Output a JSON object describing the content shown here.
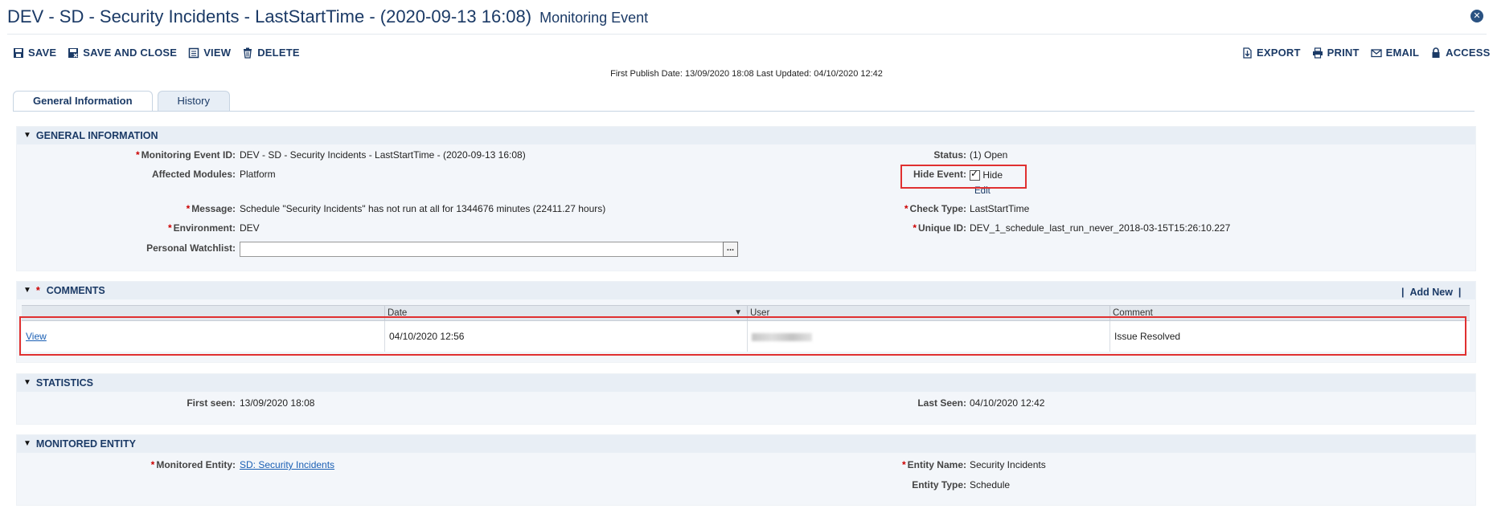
{
  "header": {
    "title": "DEV - SD - Security Incidents - LastStartTime - (2020-09-13 16:08)",
    "subtitle": "Monitoring Event",
    "close_icon": "close-icon"
  },
  "toolbar": {
    "left": [
      {
        "label": "SAVE",
        "icon": "save-icon"
      },
      {
        "label": "SAVE AND CLOSE",
        "icon": "save-close-icon"
      },
      {
        "label": "VIEW",
        "icon": "view-icon"
      },
      {
        "label": "DELETE",
        "icon": "trash-icon"
      }
    ],
    "right": [
      {
        "label": "EXPORT",
        "icon": "export-icon"
      },
      {
        "label": "PRINT",
        "icon": "printer-icon"
      },
      {
        "label": "EMAIL",
        "icon": "envelope-icon"
      },
      {
        "label": "ACCESS",
        "icon": "lock-icon"
      }
    ]
  },
  "publish_info": "First Publish Date: 13/09/2020 18:08 Last Updated: 04/10/2020 12:42",
  "tabs": [
    {
      "label": "General Information",
      "active": true
    },
    {
      "label": "History",
      "active": false
    }
  ],
  "general": {
    "heading": "GENERAL INFORMATION",
    "monitoring_event_id": {
      "label": "Monitoring Event ID:",
      "value": "DEV - SD - Security Incidents - LastStartTime - (2020-09-13 16:08)"
    },
    "affected_modules": {
      "label": "Affected Modules:",
      "value": "Platform"
    },
    "message": {
      "label": "Message:",
      "value": "Schedule \"Security Incidents\" has not run at all for 1344676 minutes (22411.27 hours)"
    },
    "environment": {
      "label": "Environment:",
      "value": "DEV"
    },
    "watchlist": {
      "label": "Personal Watchlist:",
      "value": "",
      "button": "..."
    },
    "status": {
      "label": "Status:",
      "value": "(1) Open"
    },
    "hide_event": {
      "label": "Hide Event:",
      "value": "Hide",
      "checked": true,
      "edit_label": "Edit"
    },
    "check_type": {
      "label": "Check Type:",
      "value": "LastStartTime"
    },
    "unique_id": {
      "label": "Unique ID:",
      "value": "DEV_1_schedule_last_run_never_2018-03-15T15:26:10.227"
    }
  },
  "comments": {
    "heading": "COMMENTS",
    "add_new": "Add New",
    "columns": [
      "Date",
      "User",
      "Comment"
    ],
    "rows": [
      {
        "link": "View",
        "date": "04/10/2020 12:56",
        "comment": "Issue Resolved"
      }
    ]
  },
  "statistics": {
    "heading": "STATISTICS",
    "first_seen": {
      "label": "First seen:",
      "value": "13/09/2020 18:08"
    },
    "last_seen": {
      "label": "Last Seen:",
      "value": "04/10/2020 12:42"
    }
  },
  "monitored": {
    "heading": "MONITORED ENTITY",
    "monitored_entity": {
      "label": "Monitored Entity:",
      "value": "SD: Security Incidents"
    },
    "entity_name": {
      "label": "Entity Name:",
      "value": "Security Incidents"
    },
    "entity_type": {
      "label": "Entity Type:",
      "value": "Schedule"
    }
  },
  "colors": {
    "title": "#1b3a66",
    "accent": "#1a5fb4",
    "highlight": "#e03030",
    "required": "#cc0000"
  }
}
